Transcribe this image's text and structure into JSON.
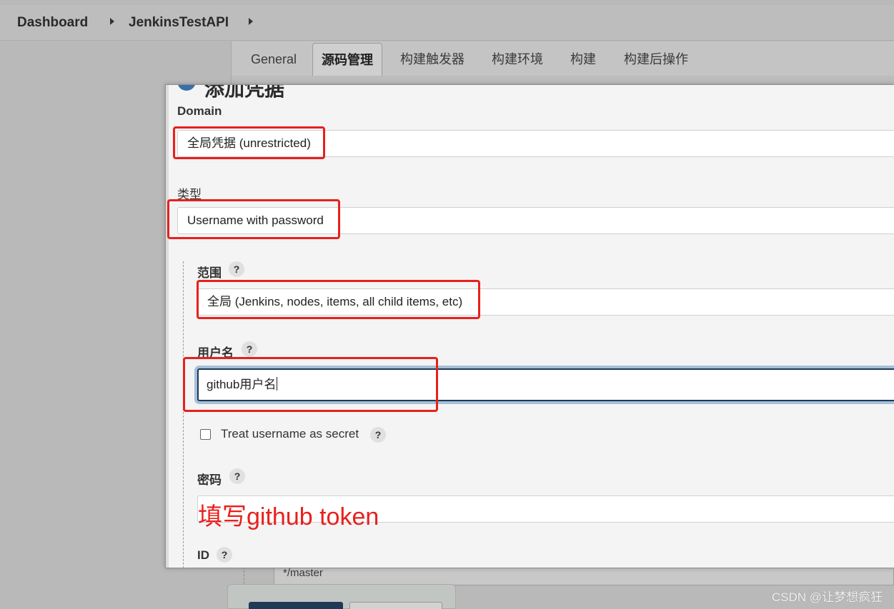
{
  "breadcrumb": {
    "items": [
      "Dashboard",
      "JenkinsTestAPI"
    ]
  },
  "tabs": [
    {
      "label": "General",
      "active": false
    },
    {
      "label": "源码管理",
      "active": true
    },
    {
      "label": "构建触发器",
      "active": false
    },
    {
      "label": "构建环境",
      "active": false
    },
    {
      "label": "构建",
      "active": false
    },
    {
      "label": "构建后操作",
      "active": false
    }
  ],
  "background": {
    "branch_value": "*/master"
  },
  "dialog": {
    "title": "添加凭据",
    "domain": {
      "label": "Domain",
      "value": "全局凭据 (unrestricted)"
    },
    "kind": {
      "label": "类型",
      "value": "Username with password"
    },
    "scope": {
      "label": "范围",
      "value": "全局 (Jenkins, nodes, items, all child items, etc)"
    },
    "username": {
      "label": "用户名",
      "value": "github用户名"
    },
    "treat_secret": {
      "label": "Treat username as secret",
      "checked": false
    },
    "password": {
      "label": "密码",
      "value": ""
    },
    "id": {
      "label": "ID"
    },
    "help_symbol": "?"
  },
  "annotation": {
    "password_note": "填写github token",
    "color": "#e8201c"
  },
  "watermark": "CSDN @让梦想疯狂",
  "colors": {
    "focus_border": "#1b3a57",
    "focus_ring": "#a6bfd6"
  }
}
